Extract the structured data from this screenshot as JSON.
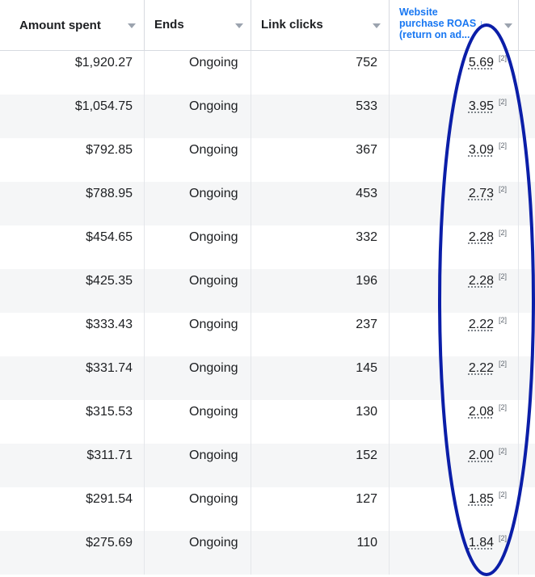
{
  "columns": {
    "amount_spent": "Amount spent",
    "ends": "Ends",
    "link_clicks": "Link clicks",
    "roas": "Website\npurchase ROAS ↓\n(return on ad..."
  },
  "footnote_marker": "[2]",
  "rows": [
    {
      "amount": "$1,920.27",
      "ends": "Ongoing",
      "clicks": "752",
      "roas": "5.69"
    },
    {
      "amount": "$1,054.75",
      "ends": "Ongoing",
      "clicks": "533",
      "roas": "3.95"
    },
    {
      "amount": "$792.85",
      "ends": "Ongoing",
      "clicks": "367",
      "roas": "3.09"
    },
    {
      "amount": "$788.95",
      "ends": "Ongoing",
      "clicks": "453",
      "roas": "2.73"
    },
    {
      "amount": "$454.65",
      "ends": "Ongoing",
      "clicks": "332",
      "roas": "2.28"
    },
    {
      "amount": "$425.35",
      "ends": "Ongoing",
      "clicks": "196",
      "roas": "2.28"
    },
    {
      "amount": "$333.43",
      "ends": "Ongoing",
      "clicks": "237",
      "roas": "2.22"
    },
    {
      "amount": "$331.74",
      "ends": "Ongoing",
      "clicks": "145",
      "roas": "2.22"
    },
    {
      "amount": "$315.53",
      "ends": "Ongoing",
      "clicks": "130",
      "roas": "2.08"
    },
    {
      "amount": "$311.71",
      "ends": "Ongoing",
      "clicks": "152",
      "roas": "2.00"
    },
    {
      "amount": "$291.54",
      "ends": "Ongoing",
      "clicks": "127",
      "roas": "1.85"
    },
    {
      "amount": "$275.69",
      "ends": "Ongoing",
      "clicks": "110",
      "roas": "1.84"
    }
  ],
  "colors": {
    "accent": "#1877f2",
    "highlight_ellipse": "#0b1ea8",
    "alt_row": "#f5f6f7"
  }
}
